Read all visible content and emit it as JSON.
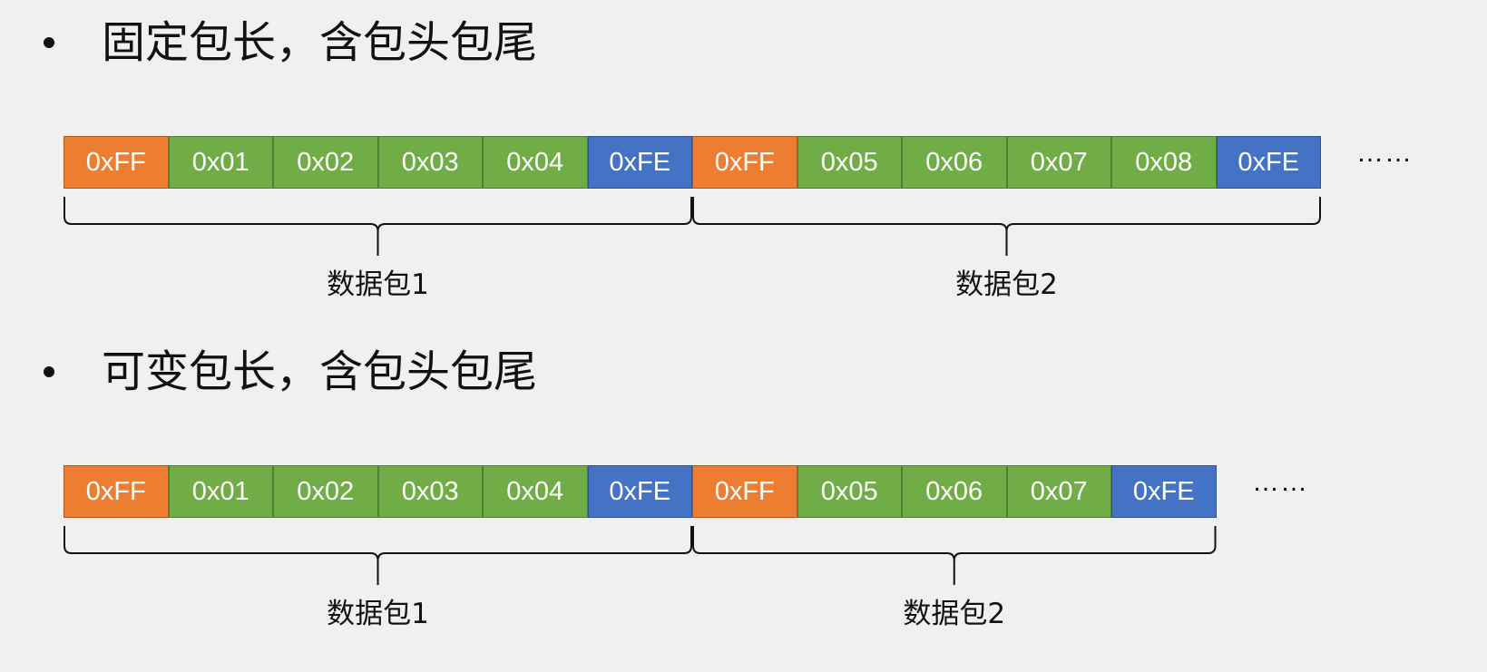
{
  "sections": [
    {
      "heading": "固定包长，含包头包尾",
      "cells": [
        {
          "label": "0xFF",
          "kind": "header"
        },
        {
          "label": "0x01",
          "kind": "payload"
        },
        {
          "label": "0x02",
          "kind": "payload"
        },
        {
          "label": "0x03",
          "kind": "payload"
        },
        {
          "label": "0x04",
          "kind": "payload"
        },
        {
          "label": "0xFE",
          "kind": "trailer"
        },
        {
          "label": "0xFF",
          "kind": "header"
        },
        {
          "label": "0x05",
          "kind": "payload"
        },
        {
          "label": "0x06",
          "kind": "payload"
        },
        {
          "label": "0x07",
          "kind": "payload"
        },
        {
          "label": "0x08",
          "kind": "payload"
        },
        {
          "label": "0xFE",
          "kind": "trailer"
        }
      ],
      "ellipsis": "……",
      "packets": [
        {
          "label": "数据包1",
          "first_cell": 0,
          "last_cell": 5
        },
        {
          "label": "数据包2",
          "first_cell": 6,
          "last_cell": 11
        }
      ]
    },
    {
      "heading": "可变包长，含包头包尾",
      "cells": [
        {
          "label": "0xFF",
          "kind": "header"
        },
        {
          "label": "0x01",
          "kind": "payload"
        },
        {
          "label": "0x02",
          "kind": "payload"
        },
        {
          "label": "0x03",
          "kind": "payload"
        },
        {
          "label": "0x04",
          "kind": "payload"
        },
        {
          "label": "0xFE",
          "kind": "trailer"
        },
        {
          "label": "0xFF",
          "kind": "header"
        },
        {
          "label": "0x05",
          "kind": "payload"
        },
        {
          "label": "0x06",
          "kind": "payload"
        },
        {
          "label": "0x07",
          "kind": "payload"
        },
        {
          "label": "0xFE",
          "kind": "trailer"
        }
      ],
      "ellipsis": "……",
      "packets": [
        {
          "label": "数据包1",
          "first_cell": 0,
          "last_cell": 5
        },
        {
          "label": "数据包2",
          "first_cell": 6,
          "last_cell": 10
        }
      ]
    }
  ],
  "colors": {
    "header": "#ed7d31",
    "payload": "#70ad47",
    "trailer": "#4472c4"
  }
}
